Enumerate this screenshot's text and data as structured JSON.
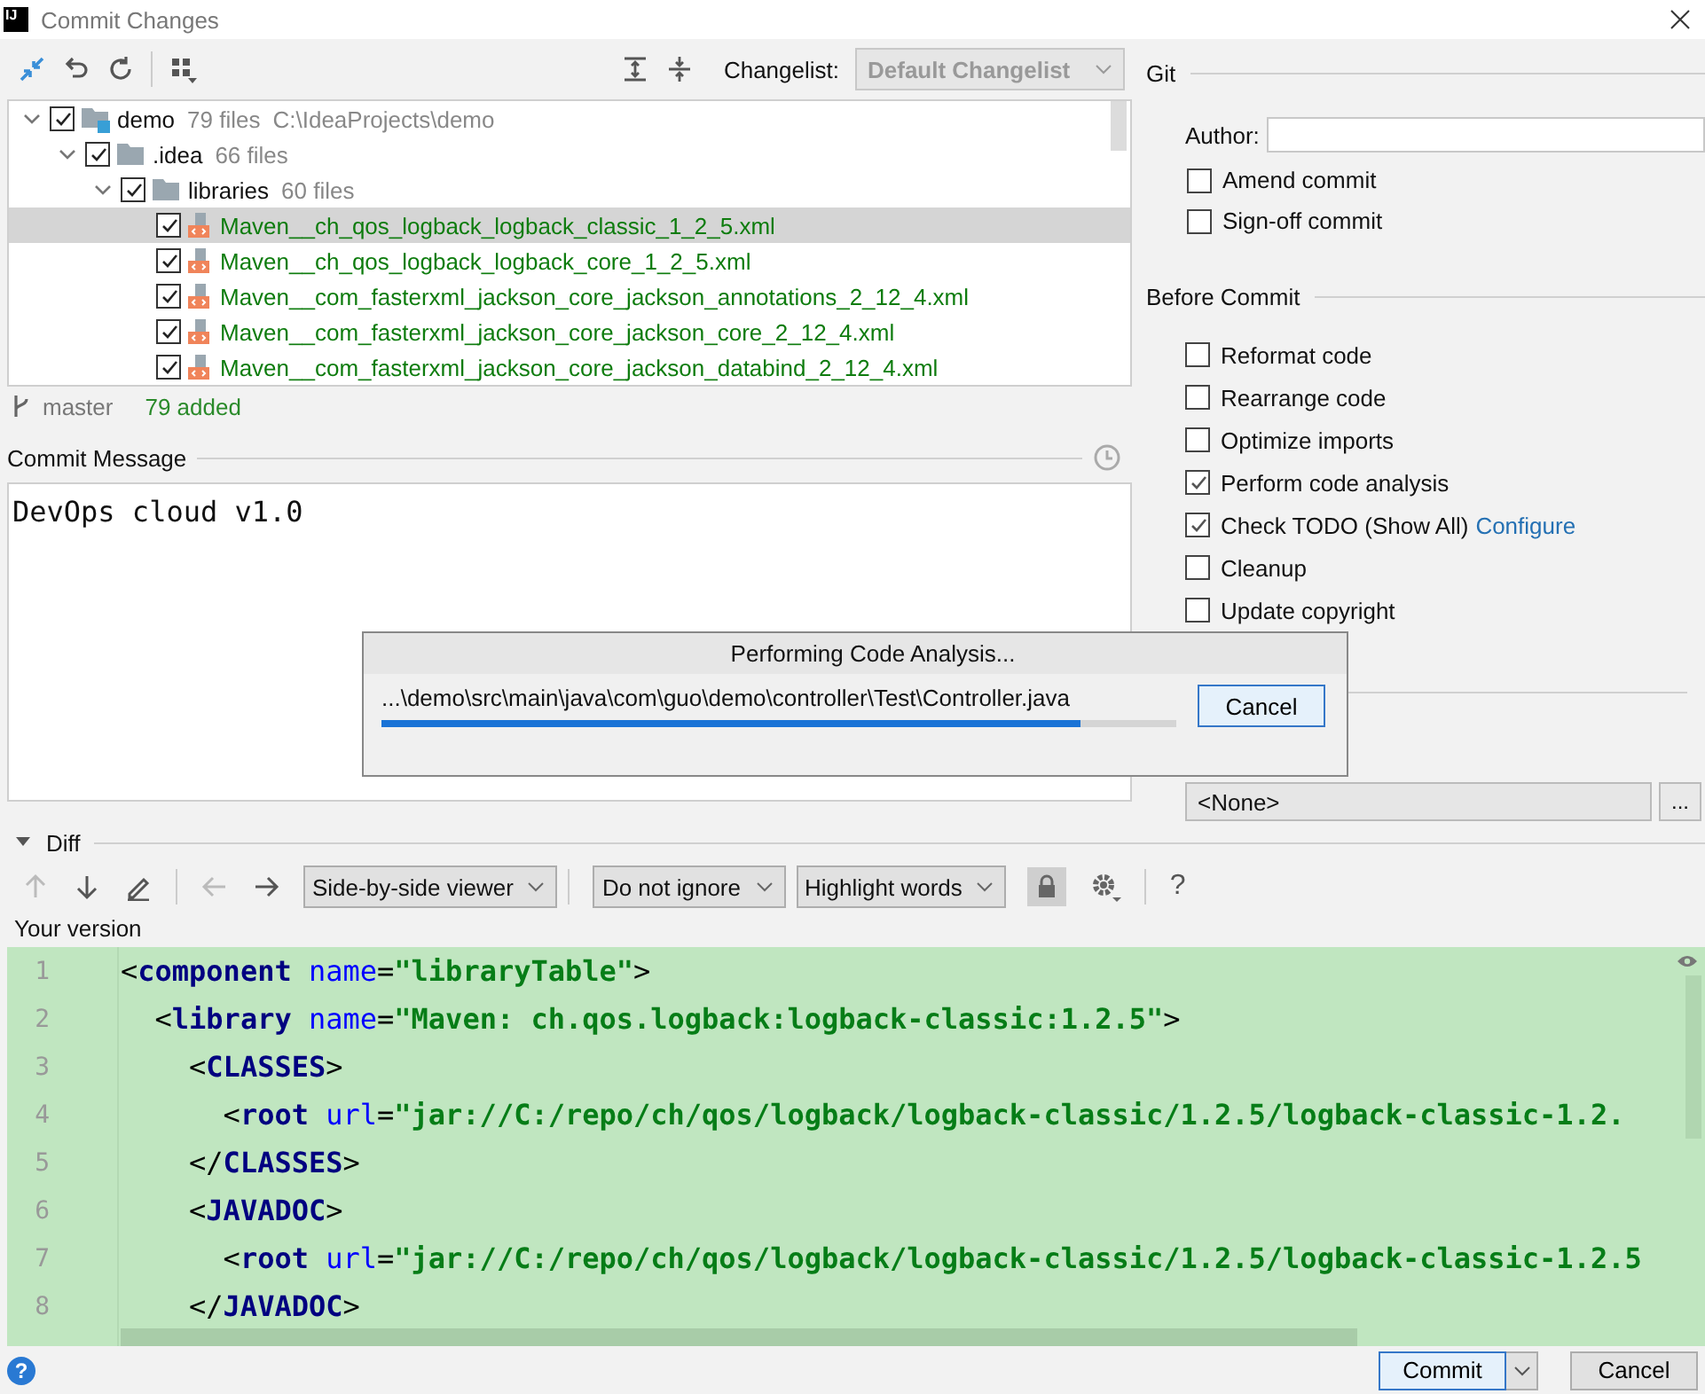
{
  "window": {
    "app_icon": "IJ",
    "title": "Commit Changes"
  },
  "changes": {
    "changelist": {
      "label": "Changelist:",
      "value": "Default Changelist",
      "disabled": true
    },
    "tree": [
      {
        "kind": "module",
        "name": "demo",
        "count": "79 files",
        "path": "C:\\IdeaProjects\\demo",
        "checked": true,
        "expanded": true,
        "selected": false,
        "children": [
          {
            "kind": "folder",
            "name": ".idea",
            "count": "66 files",
            "checked": true,
            "expanded": true,
            "selected": false,
            "children": [
              {
                "kind": "folder",
                "name": "libraries",
                "count": "60 files",
                "checked": true,
                "expanded": true,
                "selected": false,
                "children": [
                  {
                    "kind": "file",
                    "name": "Maven__ch_qos_logback_logback_classic_1_2_5.xml",
                    "checked": true,
                    "selected": true
                  },
                  {
                    "kind": "file",
                    "name": "Maven__ch_qos_logback_logback_core_1_2_5.xml",
                    "checked": true,
                    "selected": false
                  },
                  {
                    "kind": "file",
                    "name": "Maven__com_fasterxml_jackson_core_jackson_annotations_2_12_4.xml",
                    "checked": true,
                    "selected": false
                  },
                  {
                    "kind": "file",
                    "name": "Maven__com_fasterxml_jackson_core_jackson_core_2_12_4.xml",
                    "checked": true,
                    "selected": false
                  },
                  {
                    "kind": "file",
                    "name": "Maven__com_fasterxml_jackson_core_jackson_databind_2_12_4.xml",
                    "checked": true,
                    "selected": false
                  }
                ]
              }
            ]
          }
        ]
      }
    ],
    "branch": "master",
    "summary": "79 added"
  },
  "commit_message": {
    "label": "Commit Message",
    "value": "DevOps cloud v1.0"
  },
  "git": {
    "title": "Git",
    "author_label": "Author:",
    "options": [
      {
        "label": "Amend commit",
        "checked": false
      },
      {
        "label": "Sign-off commit",
        "checked": false
      }
    ]
  },
  "before_commit": {
    "title": "Before Commit",
    "options": [
      {
        "label": "Reformat code",
        "checked": false
      },
      {
        "label": "Rearrange code",
        "checked": false
      },
      {
        "label": "Optimize imports",
        "checked": false
      },
      {
        "label": "Perform code analysis",
        "checked": true
      },
      {
        "label": "Check TODO (Show All)",
        "checked": true,
        "link": "Configure"
      },
      {
        "label": "Cleanup",
        "checked": false
      },
      {
        "label": "Update copyright",
        "checked": false
      }
    ]
  },
  "profile": {
    "value": "<None>",
    "button": "..."
  },
  "diff": {
    "title": "Diff",
    "expanded": true,
    "nav": [
      {
        "kind": "up",
        "disabled": true
      },
      {
        "kind": "down",
        "disabled": false
      },
      {
        "kind": "edit",
        "disabled": false
      },
      {
        "kind": "back",
        "disabled": true
      },
      {
        "kind": "forward",
        "disabled": false
      }
    ],
    "dropdowns": [
      {
        "label": "Side-by-side viewer"
      },
      {
        "label": "Do not ignore"
      },
      {
        "label": "Highlight words"
      }
    ],
    "lock_on": true,
    "help": "?",
    "side_label": "Your version",
    "lines": [
      {
        "number": "1",
        "tokens": [
          {
            "kind": "punct",
            "text": "<"
          },
          {
            "kind": "tag",
            "text": "component"
          },
          {
            "kind": "attr",
            "text": " name"
          },
          {
            "kind": "punct",
            "text": "="
          },
          {
            "kind": "string",
            "text": "\"libraryTable\""
          },
          {
            "kind": "punct",
            "text": ">"
          }
        ]
      },
      {
        "number": "2",
        "tokens": [
          {
            "kind": "punct",
            "text": "  <"
          },
          {
            "kind": "tag",
            "text": "library"
          },
          {
            "kind": "attr",
            "text": " name"
          },
          {
            "kind": "punct",
            "text": "="
          },
          {
            "kind": "string",
            "text": "\"Maven: ch.qos.logback:logback-classic:1.2.5\""
          },
          {
            "kind": "punct",
            "text": ">"
          }
        ]
      },
      {
        "number": "3",
        "tokens": [
          {
            "kind": "punct",
            "text": "    <"
          },
          {
            "kind": "tag",
            "text": "CLASSES"
          },
          {
            "kind": "punct",
            "text": ">"
          }
        ]
      },
      {
        "number": "4",
        "tokens": [
          {
            "kind": "punct",
            "text": "      <"
          },
          {
            "kind": "tag",
            "text": "root"
          },
          {
            "kind": "attr",
            "text": " url"
          },
          {
            "kind": "punct",
            "text": "="
          },
          {
            "kind": "string",
            "text": "\"jar://C:/repo/ch/qos/logback/logback-classic/1.2.5/logback-classic-1.2."
          }
        ]
      },
      {
        "number": "5",
        "tokens": [
          {
            "kind": "punct",
            "text": "    </"
          },
          {
            "kind": "tag",
            "text": "CLASSES"
          },
          {
            "kind": "punct",
            "text": ">"
          }
        ]
      },
      {
        "number": "6",
        "tokens": [
          {
            "kind": "punct",
            "text": "    <"
          },
          {
            "kind": "tag",
            "text": "JAVADOC"
          },
          {
            "kind": "punct",
            "text": ">"
          }
        ]
      },
      {
        "number": "7",
        "tokens": [
          {
            "kind": "punct",
            "text": "      <"
          },
          {
            "kind": "tag",
            "text": "root"
          },
          {
            "kind": "attr",
            "text": " url"
          },
          {
            "kind": "punct",
            "text": "="
          },
          {
            "kind": "string",
            "text": "\"jar://C:/repo/ch/qos/logback/logback-classic/1.2.5/logback-classic-1.2.5"
          }
        ]
      },
      {
        "number": "8",
        "tokens": [
          {
            "kind": "punct",
            "text": "    </"
          },
          {
            "kind": "tag",
            "text": "JAVADOC"
          },
          {
            "kind": "punct",
            "text": ">"
          }
        ]
      }
    ]
  },
  "progress_dialog": {
    "title": "Performing Code Analysis...",
    "path": "...\\demo\\src\\main\\java\\com\\guo\\demo\\controller\\Test\\Controller.java",
    "level": 0.88,
    "button": "Cancel"
  },
  "footer": {
    "help": "?",
    "commit": "Commit",
    "cancel": "Cancel"
  }
}
